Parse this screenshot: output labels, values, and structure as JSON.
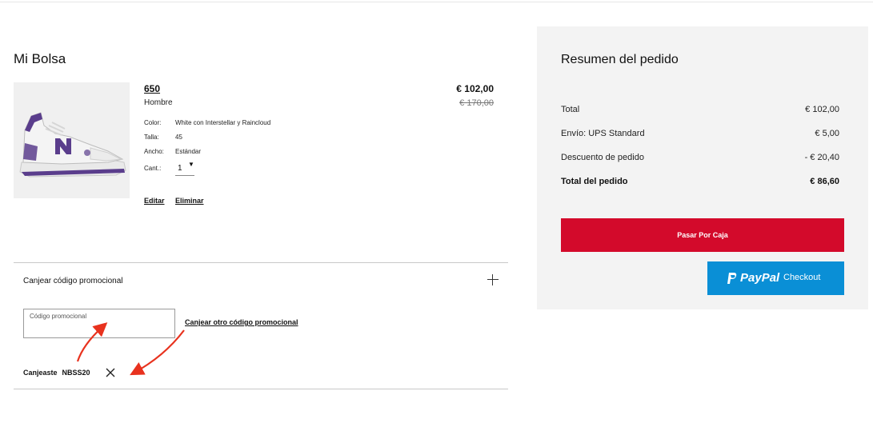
{
  "bag": {
    "title": "Mi Bolsa",
    "product": {
      "name": "650",
      "gender": "Hombre",
      "attributes": [
        {
          "label": "Color:",
          "value": "White con Interstellar y Raincloud"
        },
        {
          "label": "Talla:",
          "value": "45"
        },
        {
          "label": "Ancho:",
          "value": "Estándar"
        }
      ],
      "qty_label": "Cant.:",
      "qty_value": "1",
      "price": "€ 102,00",
      "price_original": "€ 170,00",
      "edit_label": "Editar",
      "remove_label": "Eliminar",
      "image_icon": "sneaker-image"
    },
    "promo": {
      "toggle_label": "Canjear código promocional",
      "input_placeholder": "Código promocional",
      "input_value": "",
      "redeem_other_label": "Canjear otro código promocional",
      "applied_prefix": "Canjeaste",
      "applied_code": "NBSS20"
    }
  },
  "summary": {
    "title": "Resumen del pedido",
    "rows": [
      {
        "label": "Total",
        "value": "€ 102,00"
      },
      {
        "label": "Envío: UPS Standard",
        "value": "€ 5,00"
      },
      {
        "label": "Descuento de pedido",
        "value": "- € 20,40"
      }
    ],
    "total_label": "Total del pedido",
    "total_value": "€ 86,60",
    "checkout_label": "Pasar Por Caja",
    "paypal_word": "PayPal",
    "paypal_label": "Checkout"
  },
  "colors": {
    "checkout": "#d30a2b",
    "paypal": "#0a8fd6",
    "summary_bg": "#f3f3f3",
    "annotation_arrow": "#e8321e",
    "shoe_accent": "#5a3d8c"
  }
}
